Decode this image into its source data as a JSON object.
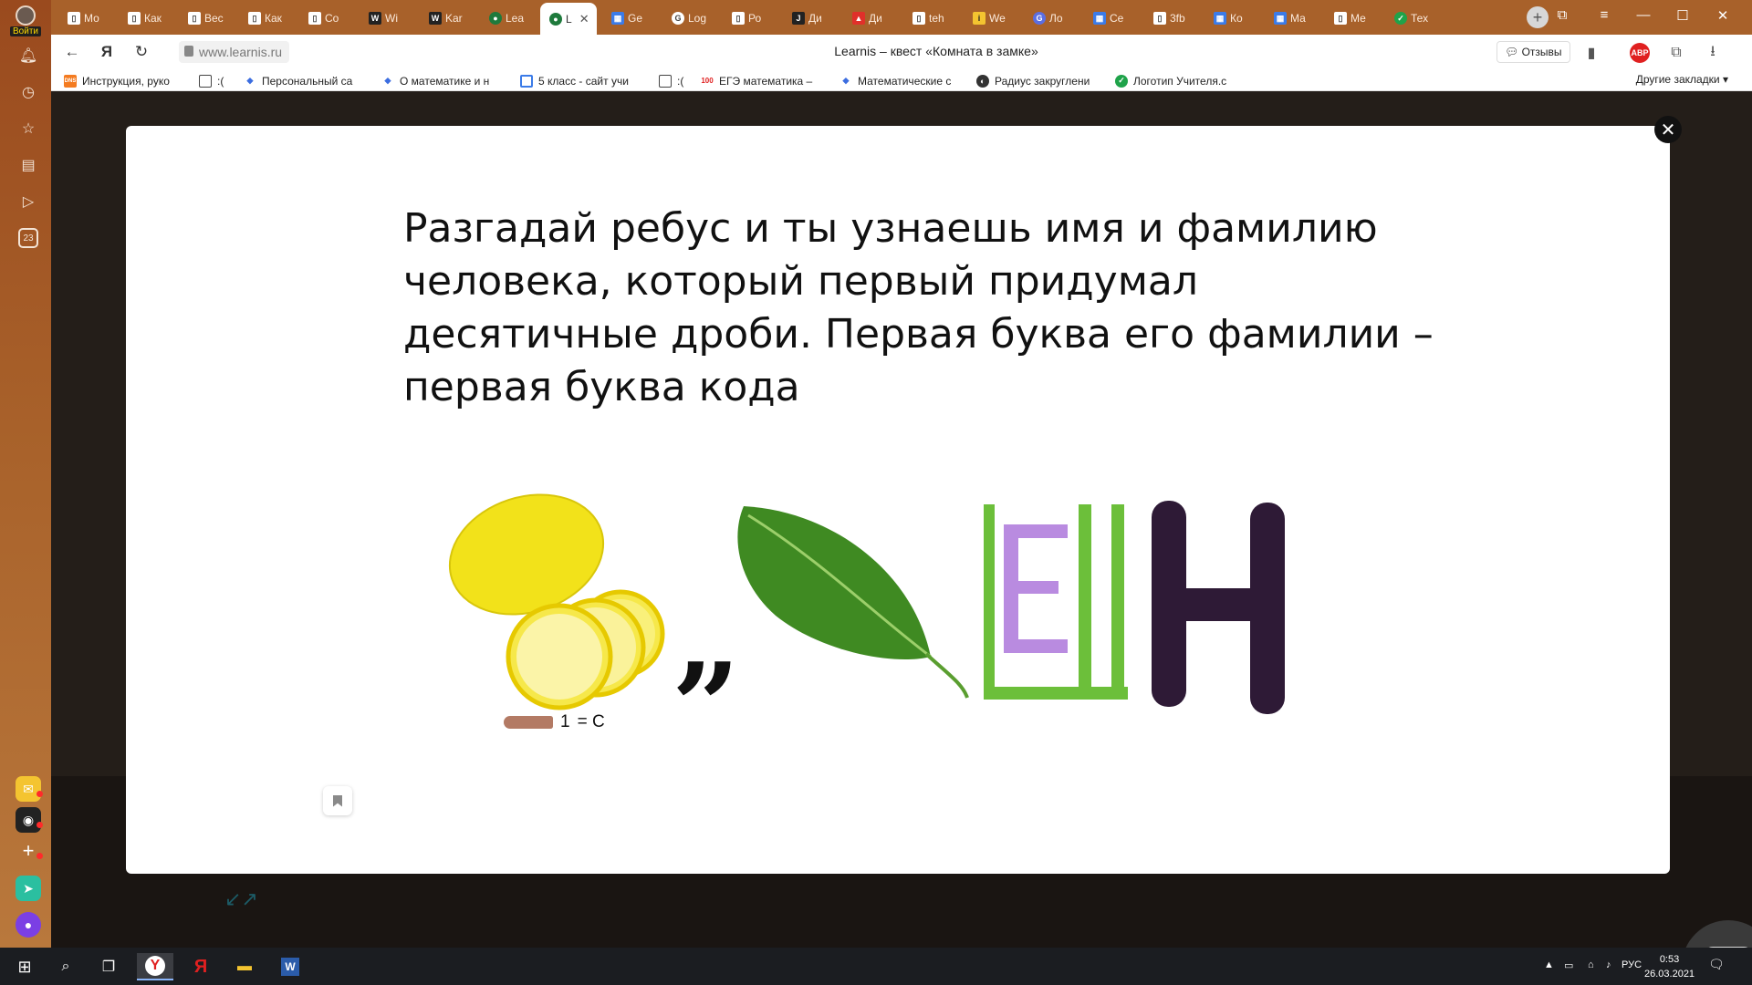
{
  "sidebar": {
    "login_label": "Войти",
    "calendar_day": "23"
  },
  "tabs": [
    {
      "label": "Мо"
    },
    {
      "label": "Как"
    },
    {
      "label": "Вес"
    },
    {
      "label": "Как"
    },
    {
      "label": "Со"
    },
    {
      "label": "Wi"
    },
    {
      "label": "Kar"
    },
    {
      "label": "Lea"
    },
    {
      "label": "L",
      "active": true
    },
    {
      "label": "Ge"
    },
    {
      "label": "Log"
    },
    {
      "label": "Ро"
    },
    {
      "label": "Ди"
    },
    {
      "label": "Ди"
    },
    {
      "label": "teh"
    },
    {
      "label": "We"
    },
    {
      "label": "Ло"
    },
    {
      "label": "Се"
    },
    {
      "label": "3fb"
    },
    {
      "label": "Ко"
    },
    {
      "label": "Ма"
    },
    {
      "label": "Ме"
    },
    {
      "label": "Тех"
    }
  ],
  "addressbar": {
    "url": "www.learnis.ru",
    "page_title": "Learnis – квест «Комната в замке»",
    "reviews_label": "Отзывы",
    "abp_label": "ABP"
  },
  "bookmarks": [
    {
      "label": "Инструкция, руко",
      "icon": "dns"
    },
    {
      "label": ":(",
      "icon": "doc"
    },
    {
      "label": "Персональный са",
      "icon": "diamond"
    },
    {
      "label": "О математике и н",
      "icon": "diamond"
    },
    {
      "label": "5 класс - сайт учи",
      "icon": "square"
    },
    {
      "label": ":(",
      "icon": "doc"
    },
    {
      "label": "ЕГЭ математика –",
      "icon": "100"
    },
    {
      "label": "Математические с",
      "icon": "diamond"
    },
    {
      "label": "Радиус закруглени",
      "icon": "owl"
    },
    {
      "label": "Логотип Учителя.с",
      "icon": "check"
    }
  ],
  "bookmarks_other": "Другие закладки",
  "modal": {
    "task_text": "Разгадай ребус и ты узнаешь имя и фамилию человека, который первый придумал десятичные дроби. Первая буква его фамилии – первая буква кода",
    "hint_number": "1",
    "hint_replace": "= С",
    "comma_glyph": "”",
    "rebus_big_letter": "Н",
    "rebus_outer_letter": "Ц",
    "rebus_inner_letter": "Е",
    "close_glyph": "✕"
  },
  "taskbar": {
    "lang": "РУС",
    "time": "0:53",
    "date": "26.03.2021",
    "yandex_browser_label": "Y",
    "yandex_label": "Я"
  },
  "colors": {
    "browser_chrome": "#a8612a",
    "page_bg": "#241e19",
    "lemon": "#f2e21a",
    "leaf": "#3f8a22",
    "ce_green": "#6cbf3a",
    "ce_purple": "#b98be0",
    "n_purple": "#2e1a36"
  }
}
